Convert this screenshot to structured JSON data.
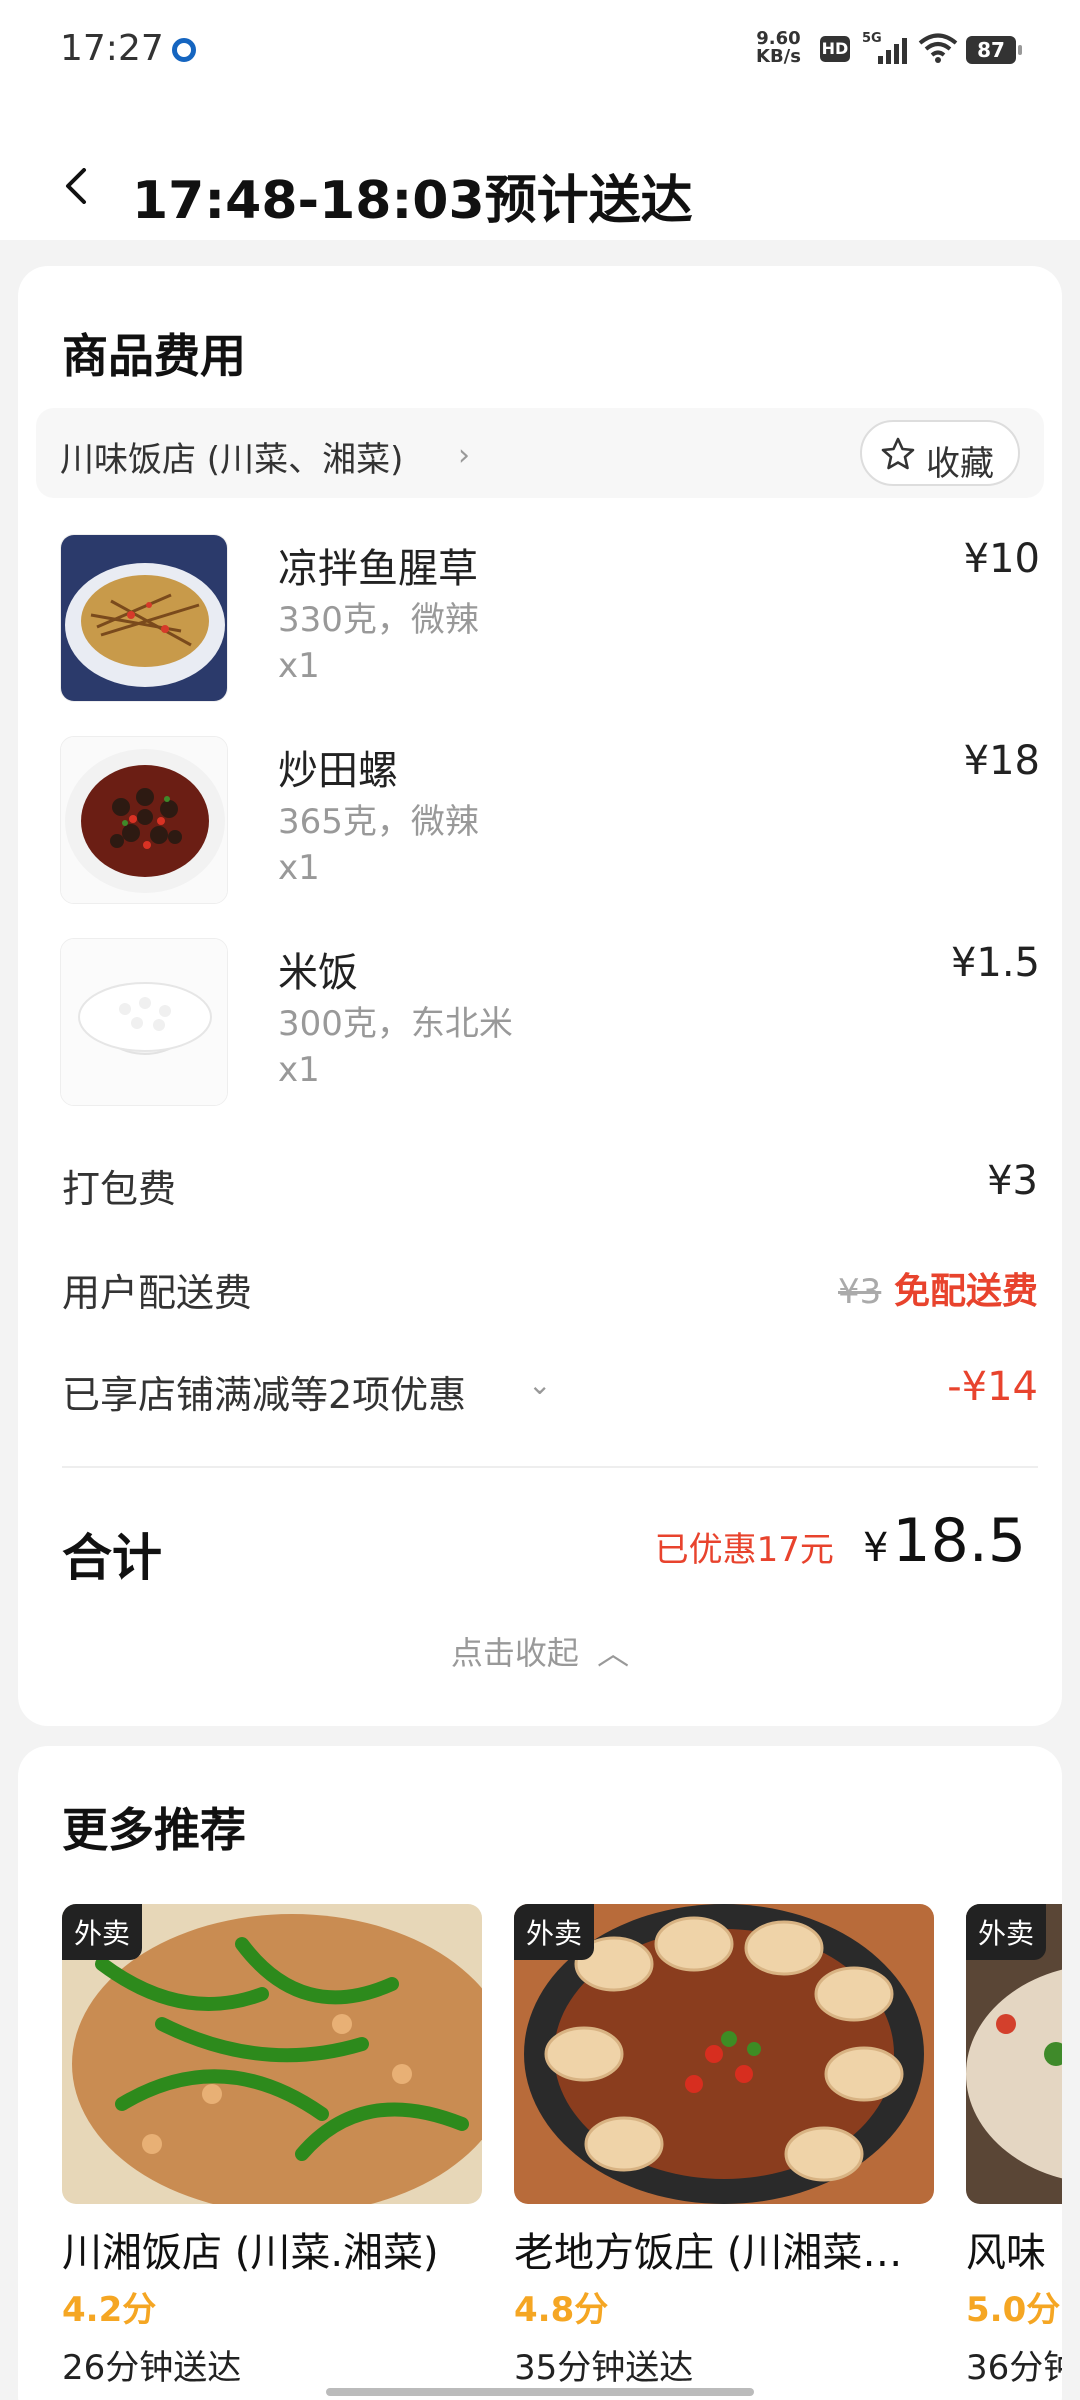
{
  "status_bar": {
    "time": "17:27",
    "net_speed": "9.60",
    "net_unit": "KB/s",
    "hd": "HD",
    "signal": "5G",
    "battery": "87"
  },
  "header": {
    "title": "17:48-18:03预计送达"
  },
  "goods": {
    "section_title": "商品费用",
    "shop_name": "川味饭店 (川菜、湘菜)",
    "favorite_label": "收藏",
    "items": [
      {
        "name": "凉拌鱼腥草",
        "spec": "330克，微辣",
        "qty": "x1",
        "price": "¥10"
      },
      {
        "name": "炒田螺",
        "spec": "365克，微辣",
        "qty": "x1",
        "price": "¥18"
      },
      {
        "name": "米饭",
        "spec": "300克，东北米",
        "qty": "x1",
        "price": "¥1.5"
      }
    ],
    "packing_fee_label": "打包费",
    "packing_fee": "¥3",
    "delivery_fee_label": "用户配送费",
    "delivery_fee_original": "¥3",
    "delivery_fee_free": "免配送费",
    "discount_label": "已享店铺满减等2项优惠",
    "discount_value": "-¥14",
    "total_label": "合计",
    "saved_text": "已优惠17元",
    "total_currency": "¥",
    "total_value": "18.5",
    "collapse_label": "点击收起"
  },
  "recommend": {
    "section_title": "更多推荐",
    "cards": [
      {
        "tag": "外卖",
        "name": "川湘饭店 (川菜.湘菜)",
        "score": "4.2分",
        "eta": "26分钟送达"
      },
      {
        "tag": "外卖",
        "name": "老地方饭庄 (川湘菜…",
        "score": "4.8分",
        "eta": "35分钟送达"
      },
      {
        "tag": "外卖",
        "name": "风味",
        "score": "5.0分",
        "eta": "36分钟"
      }
    ]
  },
  "colors": {
    "accent_red": "#e8432d",
    "score_orange": "#f5a623"
  }
}
